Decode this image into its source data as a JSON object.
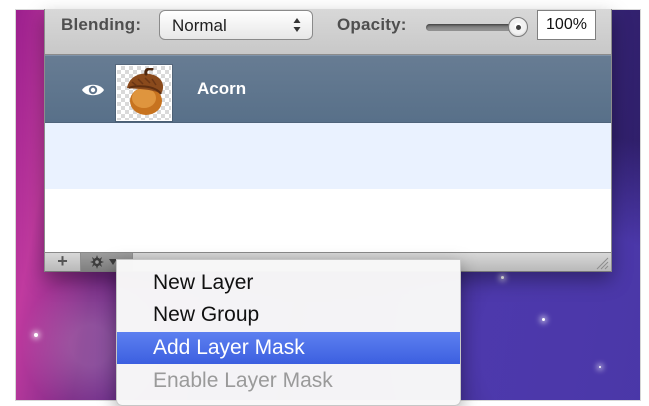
{
  "panel": {
    "blending_label": "Blending:",
    "blending_value": "Normal",
    "opacity_label": "Opacity:",
    "opacity_value": "100%",
    "opacity_level": 1.0
  },
  "layers": [
    {
      "name": "Acorn",
      "visible": true,
      "thumbnail_icon": "acorn-thumbnail-icon",
      "selected": true
    }
  ],
  "bottom_bar": {
    "add_label": "+",
    "gear_icon": "gear-icon",
    "chevron_icon": "chevron-down-icon"
  },
  "menu": {
    "items": [
      {
        "label": "New Layer",
        "state": "normal"
      },
      {
        "label": "New Group",
        "state": "normal"
      },
      {
        "label": "Add Layer Mask",
        "state": "highlighted"
      },
      {
        "label": "Enable Layer Mask",
        "state": "disabled"
      }
    ]
  },
  "colors": {
    "selected_layer_bg": "#5f748c",
    "alternate_row_bg": "#eaf2ff",
    "menu_highlight": "#4a6ce8",
    "menu_disabled_text": "#9a9a9a",
    "background_purple": "#4b2585"
  }
}
